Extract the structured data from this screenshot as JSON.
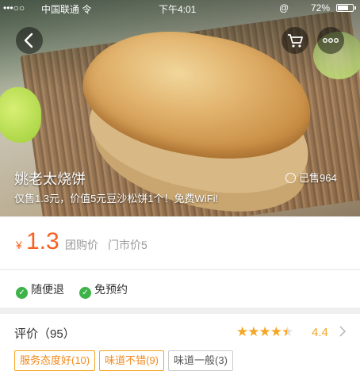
{
  "status_bar": {
    "signal": "•••○○",
    "carrier": "中国联通 令",
    "time": "下午4:01",
    "alarm_icon": "@",
    "battery_pct": "72%",
    "battery_level": 0.72
  },
  "header": {
    "back_icon": "chevron-left",
    "cart_icon": "shopping-cart",
    "more_icon": "ellipsis"
  },
  "deal": {
    "title": "姚老太烧饼",
    "sold": "已售964",
    "subtitle": "仅售1.3元，价值5元豆沙松饼1个！免费WiFi!",
    "currency": "¥",
    "price": "1.3",
    "group_label": "团购价",
    "store_price": "门市价5"
  },
  "guarantees": [
    {
      "label": "随便退"
    },
    {
      "label": "免预约"
    }
  ],
  "review": {
    "title": "评价（95）",
    "rating": 4.4,
    "rating_text": "4.4",
    "tags": [
      {
        "label": "服务态度好(10)",
        "style": "highlight"
      },
      {
        "label": "味道不错(9)",
        "style": "highlight"
      },
      {
        "label": "味道一般(3)",
        "style": "plain"
      }
    ]
  },
  "colors": {
    "accent": "#f76120",
    "star": "#f5a623",
    "check": "#3db34a"
  }
}
